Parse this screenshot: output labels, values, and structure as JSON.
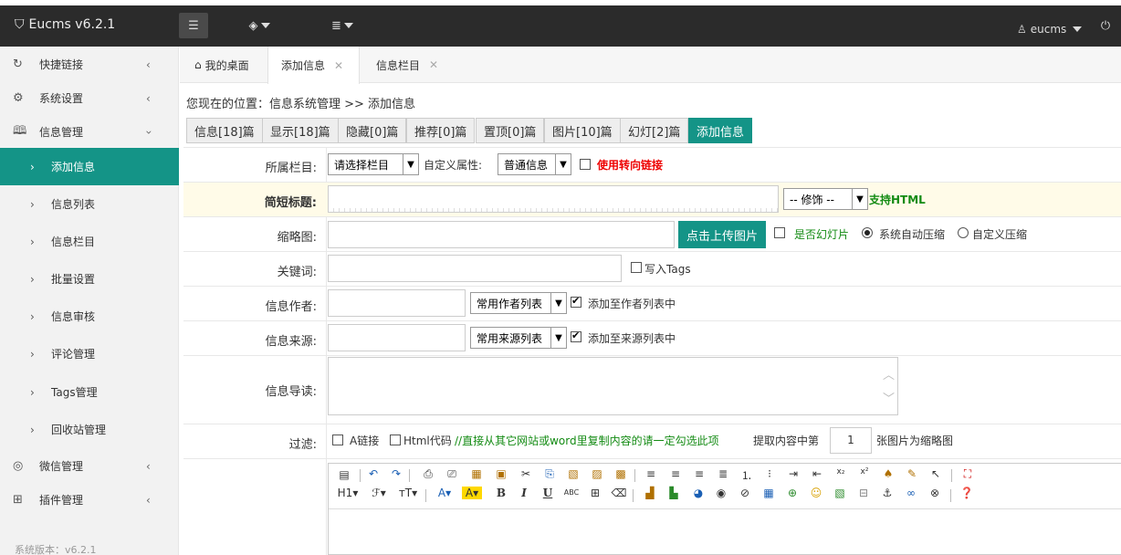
{
  "app": {
    "title": "Eucms v6.2.1",
    "user": "eucms",
    "version_label": "系统版本：v6.2.1"
  },
  "colors": {
    "accent": "#149487",
    "topbar": "#2b2b2b",
    "sidebar": "#f2f2f2",
    "warning": "#e00000",
    "green_text": "#138b13"
  },
  "sidebar": {
    "items": [
      {
        "label": "快捷链接",
        "icon": "refresh-icon"
      },
      {
        "label": "系统设置",
        "icon": "gear-icon"
      },
      {
        "label": "信息管理",
        "icon": "book-icon"
      },
      {
        "label": "微信管理",
        "icon": "chat-icon"
      },
      {
        "label": "插件管理",
        "icon": "grid-icon"
      }
    ],
    "sub_items": [
      "添加信息",
      "信息列表",
      "信息栏目",
      "批量设置",
      "信息审核",
      "评论管理",
      "Tags管理",
      "回收站管理"
    ]
  },
  "tabs": [
    {
      "label": "我的桌面"
    },
    {
      "label": "添加信息"
    },
    {
      "label": "信息栏目"
    }
  ],
  "breadcrumb": "您现在的位置：信息系统管理 >> 添加信息",
  "filter_buttons": [
    "信息[18]篇",
    "显示[18]篇",
    "隐藏[0]篇",
    "推荐[0]篇",
    "置顶[0]篇",
    "图片[10]篇",
    "幻灯[2]篇",
    "添加信息"
  ],
  "form": {
    "category": {
      "label": "所属栏目:",
      "select": "请选择栏目",
      "custom_label": "自定义属性:",
      "custom_select": "普通信息",
      "redirect_label": "使用转向链接"
    },
    "title": {
      "label": "简短标题:",
      "deco_select": "-- 修饰 --",
      "html_support": "支持HTML"
    },
    "thumb": {
      "label": "缩略图:",
      "upload": "点击上传图片",
      "slide": "是否幻灯片",
      "auto": "系统自动压缩",
      "custom": "自定义压缩"
    },
    "keywords": {
      "label": "关键词:",
      "tags": "写入Tags"
    },
    "author": {
      "label": "信息作者:",
      "select": "常用作者列表",
      "add": "添加至作者列表中"
    },
    "source": {
      "label": "信息来源:",
      "select": "常用来源列表",
      "add": "添加至来源列表中"
    },
    "intro": {
      "label": "信息导读:"
    },
    "filter": {
      "label": "过滤:",
      "a_link": "A链接",
      "html_code": "Html代码",
      "hint": "//直接从其它网站或word里复制内容的请一定勾选此项",
      "extract_prefix": "提取内容中第",
      "extract_value": "1",
      "extract_suffix": "张图片为缩略图"
    }
  },
  "editor": {
    "heading": "H1",
    "font_family": "ℱ",
    "font_size": "тT"
  }
}
